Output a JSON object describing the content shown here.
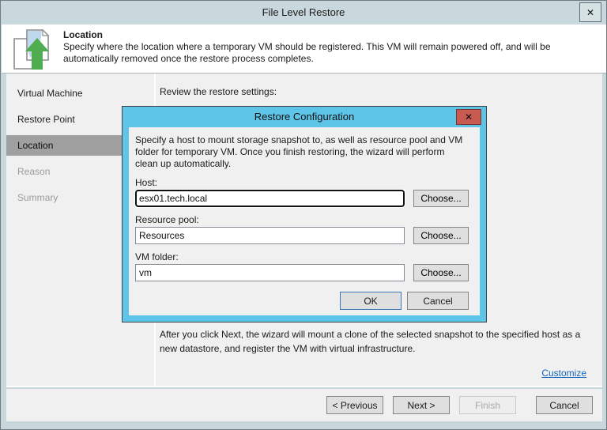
{
  "window": {
    "title": "File Level Restore"
  },
  "icons": {
    "close_glyph": "✕"
  },
  "header": {
    "title": "Location",
    "description_lines": [
      "Specify where the location where a temporary VM should be registered. This VM will remain powered off, and will be",
      "automatically removed once the restore process completes."
    ]
  },
  "sidebar": {
    "items": [
      {
        "label": "Virtual Machine",
        "state": "done"
      },
      {
        "label": "Restore Point",
        "state": "done"
      },
      {
        "label": "Location",
        "state": "active"
      },
      {
        "label": "Reason",
        "state": "pending"
      },
      {
        "label": "Summary",
        "state": "pending"
      }
    ]
  },
  "content": {
    "review_label": "Review the restore settings:",
    "next_info_lines": [
      "After you click Next, the wizard will mount a clone of the selected snapshot to the specified host as a",
      "new datastore, and register the VM with virtual infrastructure."
    ],
    "customize_link": "Customize"
  },
  "modal": {
    "title": "Restore Configuration",
    "description_lines": [
      "Specify a host to mount storage snapshot to, as well as resource pool and VM",
      "folder for temporary VM. Once you finish restoring, the wizard will perform",
      "clean up automatically."
    ],
    "fields": [
      {
        "label": "Host:",
        "value": "esx01.tech.local",
        "button": "Choose..."
      },
      {
        "label": "Resource pool:",
        "value": "Resources",
        "button": "Choose..."
      },
      {
        "label": "VM folder:",
        "value": "vm",
        "button": "Choose..."
      }
    ],
    "ok_label": "OK",
    "cancel_label": "Cancel"
  },
  "footer": {
    "previous_label": "< Previous",
    "next_label": "Next >",
    "finish_label": "Finish",
    "cancel_label": "Cancel"
  },
  "colors": {
    "modal_accent": "#5ec5e8",
    "modal_close_red": "#c75b52",
    "titlebar": "#c9d8dc",
    "sidebar_active": "#a0a0a0",
    "link_blue": "#1666c0",
    "ok_border_blue": "#3e78b4",
    "arrow_green": "#4fad4f",
    "fold_blue": "#bcd6ec"
  }
}
